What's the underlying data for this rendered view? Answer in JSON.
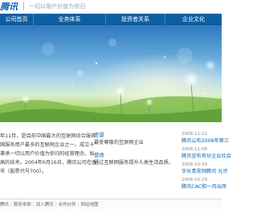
{
  "header": {
    "logo_text": "腾讯",
    "slogan": "一切以用户价值为依归"
  },
  "nav": {
    "items": [
      {
        "label": "公司首页"
      },
      {
        "label": "业务体系"
      },
      {
        "label": "投资者关系"
      },
      {
        "label": "企业文化"
      }
    ]
  },
  "intro": {
    "lines": [
      "年11月，是目前中国最大的互联网综合服务",
      "国服务用户最多的互联网企业之一。成立十",
      "秉承一切以用户价值为依归的经营理念，始",
      "高的技术。2004年6月16日，腾讯公司在香",
      "市（股票代号700）。"
    ]
  },
  "vision": {
    "label": "愿景",
    "text": "最受尊敬的互联网企业"
  },
  "mission": {
    "label": "使命",
    "text": "通过互联网服务提升人类生活品质。"
  },
  "news": [
    {
      "date": "2008-11-12",
      "title": "腾讯公布2008年第三"
    },
    {
      "date": "2008-11-08",
      "title": "腾讯宣布有份企业社会"
    },
    {
      "date": "2008-10-29",
      "title": "宇长青视频腾讯 允许"
    },
    {
      "date": "2008-10-29",
      "title": "腾讯CAC和一月出席"
    }
  ],
  "footer": {
    "links": [
      {
        "label": "腾讯"
      },
      {
        "label": "服务条款"
      },
      {
        "label": "加入腾讯"
      },
      {
        "label": "合作伙伴"
      },
      {
        "label": "网站地图"
      }
    ]
  }
}
